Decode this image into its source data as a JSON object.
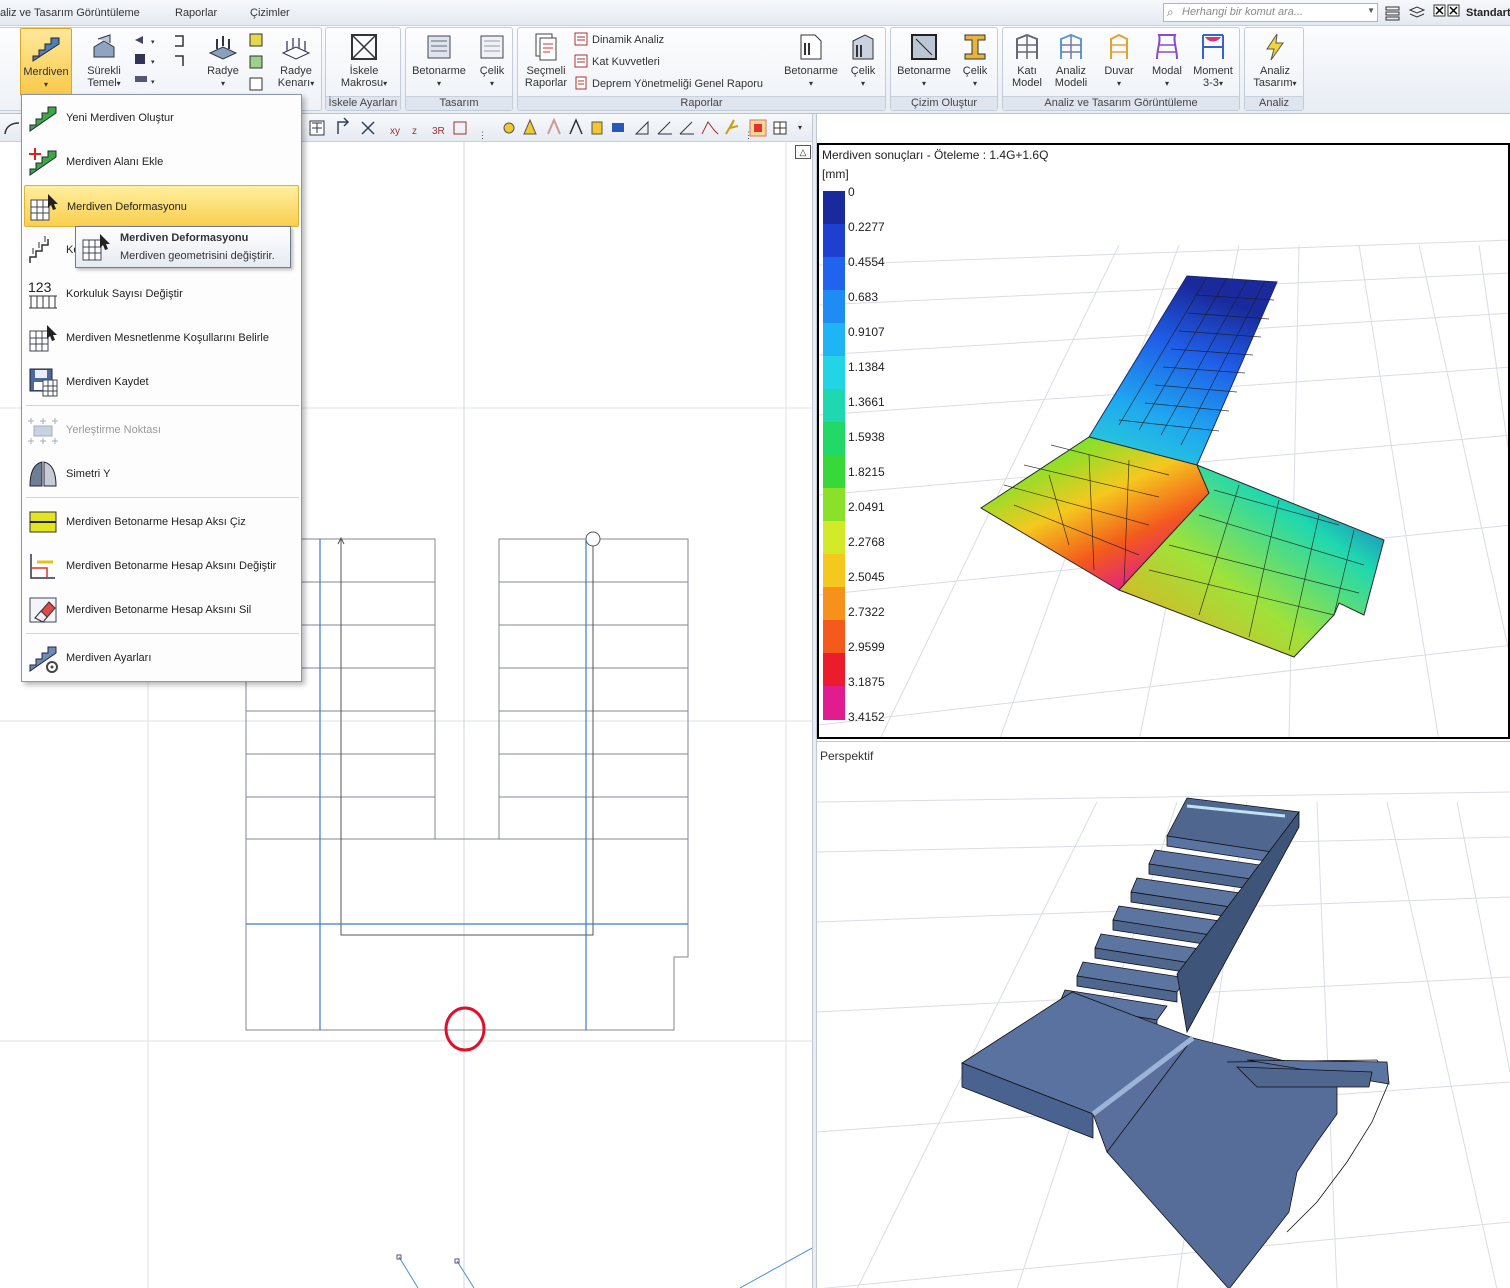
{
  "menu": {
    "tabs": [
      "aliz ve Tasarım Görüntüleme",
      "Raporlar",
      "Çizimler"
    ],
    "search_placeholder": "Herhangi bir komut ara...",
    "workspace": "Standart"
  },
  "ribbon": {
    "merdiven": "Merdiven",
    "surekli_temel_1": "Sürekli",
    "surekli_temel_2": "Temel",
    "radye": "Radye",
    "radye_kenari_1": "Radye",
    "radye_kenari_2": "Kenarı",
    "iskele_makrosu_1": "İskele",
    "iskele_makrosu_2": "Makrosu",
    "group_iskele": "İskele Ayarları",
    "tasarim_betonarme": "Betonarme",
    "tasarim_celik": "Çelik",
    "group_tasarim": "Tasarım",
    "secmeli_raporlar_1": "Seçmeli",
    "secmeli_raporlar_2": "Raporlar",
    "dinamik_analiz": "Dinamik Analiz",
    "kat_kuvvetleri": "Kat Kuvvetleri",
    "deprem_raporu": "Deprem Yönetmeliği Genel Raporu",
    "rapor_betonarme": "Betonarme",
    "rapor_celik": "Çelik",
    "group_raporlar": "Raporlar",
    "cizim_betonarme": "Betonarme",
    "cizim_celik": "Çelik",
    "group_cizim": "Çizim Oluştur",
    "kati_model_1": "Katı",
    "kati_model_2": "Model",
    "analiz_modeli_1": "Analiz",
    "analiz_modeli_2": "Modeli",
    "duvar": "Duvar",
    "modal": "Modal",
    "moment_1": "Moment",
    "moment_2": "3-3",
    "group_analiz_tasarim": "Analiz ve Tasarım Görüntüleme",
    "analiz_tasarim_1": "Analiz",
    "analiz_tasarim_2": "Tasarım",
    "group_analiz": "Analiz"
  },
  "dropdown": {
    "items": [
      "Yeni Merdiven Oluştur",
      "Merdiven Alanı Ekle",
      "Merdiven Deformasyonu",
      "Ko",
      "Korkuluk Sayısı Değiştir",
      "Merdiven Mesnetlenme Koşullarını Belirle",
      "Merdiven Kaydet",
      "Yerleştirme Noktası",
      "Simetri Y",
      "Merdiven Betonarme Hesap Aksı Çiz",
      "Merdiven Betonarme Hesap Aksını Değiştir",
      "Merdiven Betonarme Hesap Aksını Sil",
      "Merdiven Ayarları"
    ],
    "tooltip_title": "Merdiven Deformasyonu",
    "tooltip_desc": "Merdiven geometrisini değiştirir."
  },
  "results": {
    "title": "Merdiven sonuçları - Öteleme : 1.4G+1.6Q",
    "unit": "[mm]",
    "legend": [
      "0",
      "0.2277",
      "0.4554",
      "0.683",
      "0.9107",
      "1.1384",
      "1.3661",
      "1.5938",
      "1.8215",
      "2.0491",
      "2.2768",
      "2.5045",
      "2.7322",
      "2.9599",
      "3.1875",
      "3.4152"
    ],
    "legend_colors": [
      "#1a2a9c",
      "#1f3fd0",
      "#1f63ee",
      "#1f8cf4",
      "#1fb4f3",
      "#22d4e4",
      "#1fd8b0",
      "#22d866",
      "#38d83a",
      "#8be02a",
      "#d2ea28",
      "#f5c81e",
      "#f6921c",
      "#f35a1c",
      "#ec1c2c",
      "#e01c8e"
    ]
  },
  "perspective": {
    "title": "Perspektif"
  }
}
